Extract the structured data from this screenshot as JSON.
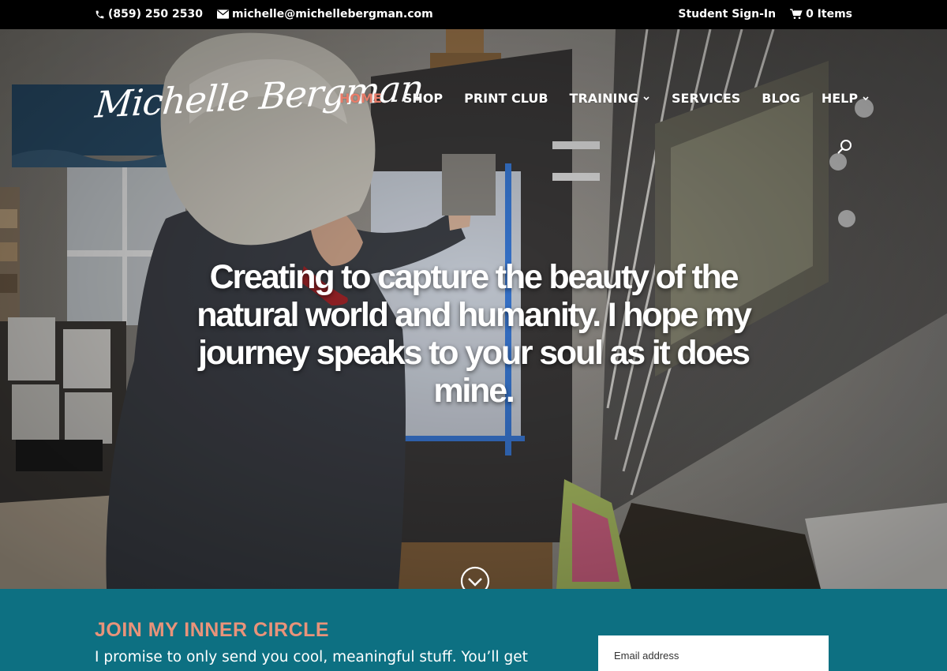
{
  "topbar": {
    "phone": "(859) 250 2530",
    "email": "michelle@michellebergman.com",
    "student_signin": "Student Sign-In",
    "cart": "0 Items",
    "icons": [
      "phone-icon",
      "email-icon",
      "cart-icon"
    ]
  },
  "header": {
    "logo_text": "Michelle Bergman",
    "nav": [
      {
        "label": "HOME",
        "active": true
      },
      {
        "label": "SHOP"
      },
      {
        "label": "PRINT CLUB"
      },
      {
        "label": "TRAINING",
        "dropdown": true
      },
      {
        "label": "SERVICES"
      },
      {
        "label": "BLOG"
      },
      {
        "label": "HELP",
        "dropdown": true
      }
    ],
    "search_icon": "search-icon"
  },
  "hero": {
    "headline": "Creating to capture the beauty of the natural world and humanity. I hope my journey speaks to your soul as it does mine.",
    "scroll_icon": "chevron-down-circle-icon"
  },
  "signup": {
    "title": "JOIN MY INNER CIRCLE",
    "text": "I promise to only send you cool, meaningful stuff. You’ll get",
    "email_placeholder": "Email address"
  },
  "colors": {
    "topbar_bg": "#000000",
    "nav_active": "#e77d6a",
    "signup_bg": "#0d7082",
    "signup_title": "#e9937a"
  }
}
